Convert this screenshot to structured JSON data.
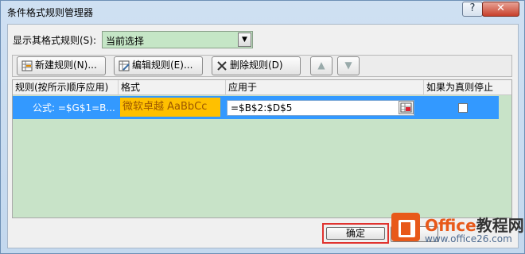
{
  "window": {
    "title": "条件格式规则管理器",
    "help_label": "?",
    "close_label": "✕"
  },
  "show_rules": {
    "label": "显示其格式规则(S):",
    "selected": "当前选择"
  },
  "toolbar": {
    "new_label": "新建规则(N)...",
    "edit_label": "编辑规则(E)...",
    "delete_label": "删除规则(D)",
    "up_label": "▲",
    "down_label": "▼"
  },
  "table": {
    "headers": {
      "rule": "规则(按所示顺序应用)",
      "format": "格式",
      "applies": "应用于",
      "stop": "如果为真则停止"
    },
    "rows": [
      {
        "rule": "公式: =$G$1=B...",
        "format_preview": "微软卓越  AaBbCc",
        "applies_to": "=$B$2:$D$5",
        "stop_if_true": false
      }
    ]
  },
  "footer": {
    "ok_label": "确定"
  },
  "watermark": {
    "brand_a": "Office",
    "brand_b": "教程网",
    "url": "www.office26.com"
  },
  "colors": {
    "selection": "#3399ff",
    "format_fill": "#ffc000",
    "format_text": "#9c5700",
    "grid_bg": "#c8e3c8",
    "highlight_box": "#e0332f",
    "brand": "#e8591a"
  }
}
